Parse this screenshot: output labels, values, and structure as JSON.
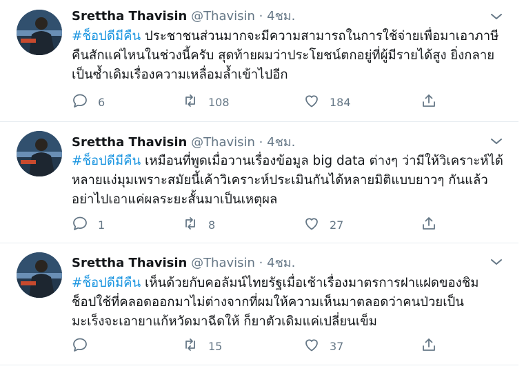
{
  "tweets": [
    {
      "name": "Srettha Thavisin",
      "handle": "@Thavisin",
      "dot": "·",
      "time": "4ชม.",
      "hashtag": "#ช็อปดีมีคืน",
      "lines": [
        " ประชาชนส่วนมากจะมีความสามารถในการใช้จ่ายเพื่อมาเอาภาษี",
        "คืนสักแค่ไหนในช่วงนี้ครับ สุดท้ายผมว่าประโยชน์ตกอยู่ที่ผู้มีรายได้สูง ยิ่งกลาย",
        "เป็นซ้ำเดิมเรื่องความเหลื่อมล้ำเข้าไปอีก"
      ],
      "replies": "6",
      "retweets": "108",
      "likes": "184"
    },
    {
      "name": "Srettha Thavisin",
      "handle": "@Thavisin",
      "dot": "·",
      "time": "4ชม.",
      "hashtag": "#ช็อปดีมีคืน",
      "lines": [
        " เหมือนที่พูดเมื่อวานเรื่องข้อมูล big data ต่างๆ ว่ามีให้วิเคราะห์ได้",
        "หลายแง่มุมเพราะสมัยนี้เค้าวิเคราะห์ประเมินกันได้หลายมิติแบบยาวๆ กันแล้ว",
        "อย่าไปเอาแค่ผลระยะสั้นมาเป็นเหตุผล"
      ],
      "replies": "1",
      "retweets": "8",
      "likes": "27"
    },
    {
      "name": "Srettha Thavisin",
      "handle": "@Thavisin",
      "dot": "·",
      "time": "4ชม.",
      "hashtag": "#ช็อปดีมีคืน",
      "lines": [
        " เห็นด้วยกับคอลัมน์ไทยรัฐเมื่อเช้าเรื่องมาตรการฝาแฝดของชิม",
        "ช็อปใช้ที่คลอดออกมาไม่ต่างจากที่ผมให้ความเห็นมาตลอดว่าคนป่วยเป็น",
        "มะเร็งจะเอายาแก้หวัดมาฉีดให้ ก็ยาตัวเดิมแค่เปลี่ยนเข็ม"
      ],
      "replies": "",
      "retweets": "15",
      "likes": "37"
    }
  ],
  "icons": {
    "reply": "reply-icon",
    "retweet": "retweet-icon",
    "like": "heart-icon",
    "share": "share-icon",
    "menu": "chevron-down-icon"
  },
  "colors": {
    "hashtag": "#1b95e0",
    "muted": "#657786",
    "text": "#14171a",
    "divider": "#e6ecf0"
  }
}
